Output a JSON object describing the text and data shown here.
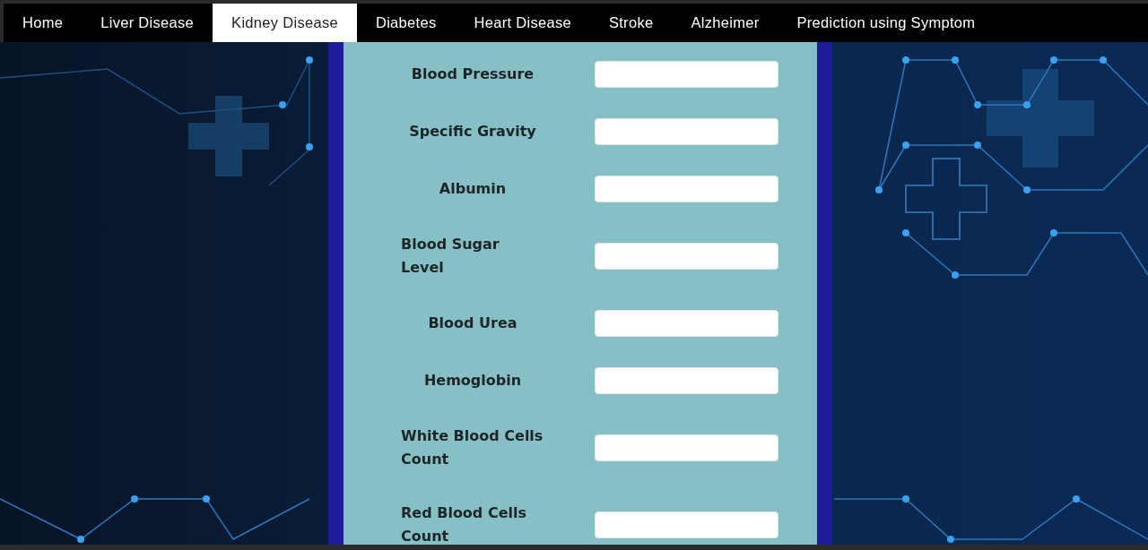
{
  "nav": {
    "items": [
      {
        "label": "Home",
        "selected": false
      },
      {
        "label": "Liver Disease",
        "selected": false
      },
      {
        "label": "Kidney Disease",
        "selected": true
      },
      {
        "label": "Diabetes",
        "selected": false
      },
      {
        "label": "Heart Disease",
        "selected": false
      },
      {
        "label": "Stroke",
        "selected": false
      },
      {
        "label": "Alzheimer",
        "selected": false
      },
      {
        "label": "Prediction using Symptom",
        "selected": false
      }
    ]
  },
  "form": {
    "fields": [
      {
        "label": "Blood Pressure"
      },
      {
        "label": "Specific Gravity"
      },
      {
        "label": "Albumin"
      },
      {
        "label": "Blood Sugar Level"
      },
      {
        "label": "Blood Urea"
      },
      {
        "label": "Hemoglobin"
      },
      {
        "label": "White Blood Cells Count"
      },
      {
        "label": "Red Blood Cells Count"
      }
    ]
  }
}
